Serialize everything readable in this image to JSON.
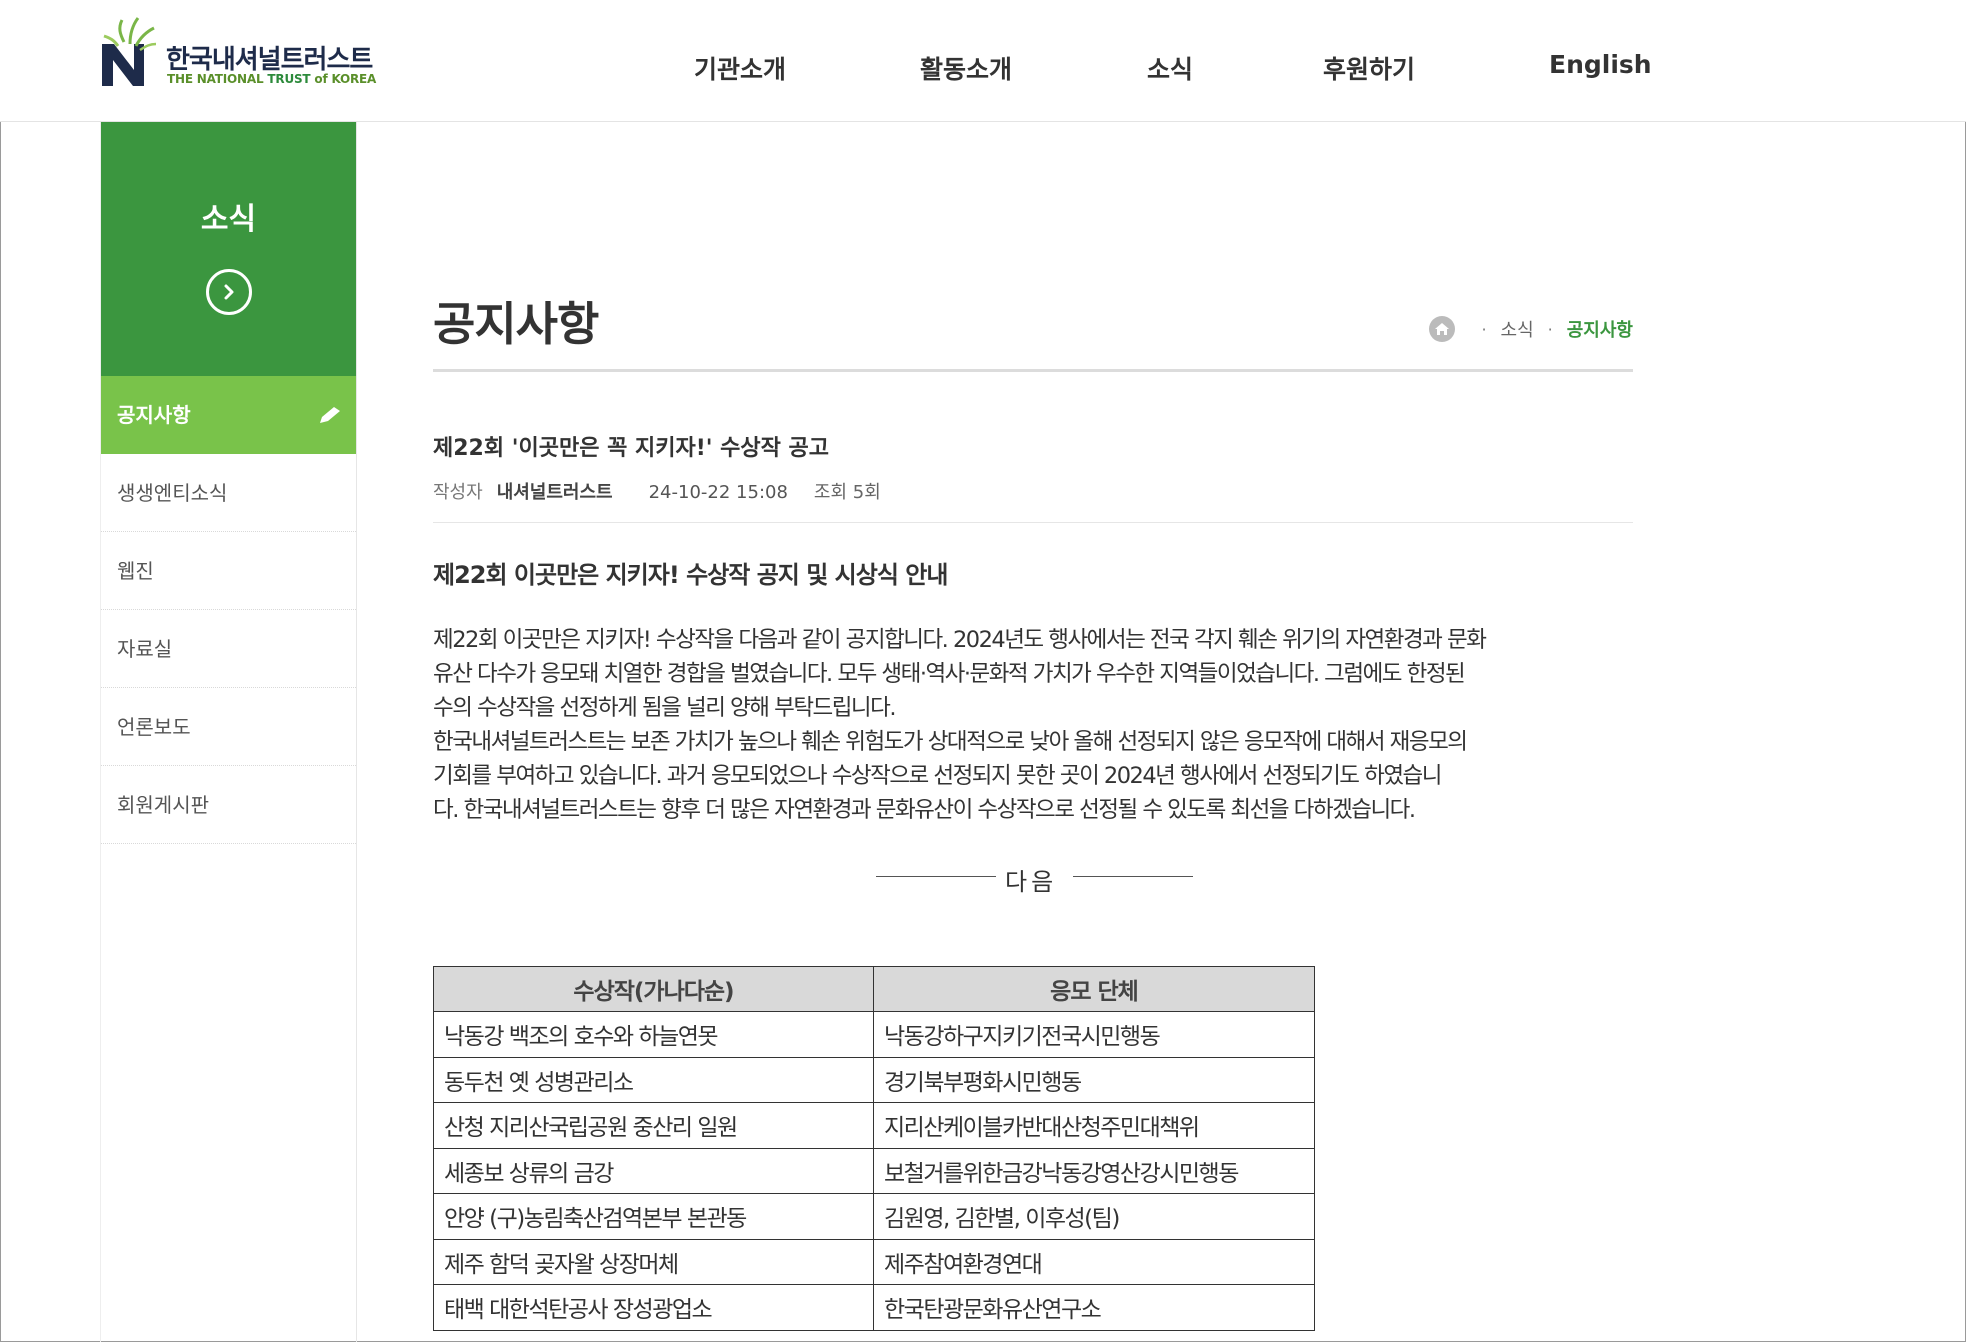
{
  "header": {
    "logo_ko": "한국내셔널트러스트",
    "logo_en_1": "THE NATIONAL ",
    "logo_en_2": "TRUST",
    "logo_en_3": " of KOREA",
    "nav": [
      "기관소개",
      "활동소개",
      "소식",
      "후원하기",
      "English"
    ]
  },
  "sidebar": {
    "title": "소식",
    "items": [
      "공지사항",
      "생생엔티소식",
      "웹진",
      "자료실",
      "언론보도",
      "회원게시판"
    ]
  },
  "page": {
    "title": "공지사항",
    "breadcrumb": [
      "소식",
      "공지사항"
    ]
  },
  "post": {
    "title": "제22회 '이곳만은 꼭 지키자!' 수상작 공고",
    "author_label": "작성자",
    "author": "내셔널트러스트",
    "date": "24-10-22 15:08",
    "views": "조회 5회",
    "heading": "제22회 이곳만은 지키자!  수상작 공지 및 시상식 안내",
    "paragraph_lines": [
      "제22회 이곳만은 지키자!  수상작을 다음과 같이 공지합니다. 2024년도 행사에서는 전국 각지 훼손 위기의 자연환경과 문화",
      "유산 다수가 응모돼 치열한 경합을 벌였습니다.  모두 생태·역사·문화적 가치가 우수한 지역들이었습니다.  그럼에도 한정된",
      "수의 수상작을 선정하게 됨을 널리 양해 부탁드립니다.",
      "한국내셔널트러스트는 보존 가치가 높으나 훼손 위험도가 상대적으로 낮아 올해 선정되지 않은 응모작에 대해서 재응모의",
      "기회를 부여하고 있습니다.  과거 응모되었으나 수상작으로 선정되지 못한 곳이  2024년 행사에서 선정되기도 하였습니",
      "다.  한국내셔널트러스트는 향후 더 많은 자연환경과 문화유산이 수상작으로 선정될 수 있도록 최선을 다하겠습니다."
    ],
    "divider": "다음",
    "table": {
      "headers": [
        "수상작(가나다순)",
        "응모 단체"
      ],
      "rows": [
        [
          "낙동강 백조의 호수와 하늘연못",
          "낙동강하구지키기전국시민행동"
        ],
        [
          "동두천 옛 성병관리소",
          "경기북부평화시민행동"
        ],
        [
          "산청 지리산국립공원 중산리 일원",
          "지리산케이블카반대산청주민대책위"
        ],
        [
          "세종보 상류의 금강",
          "보철거를위한금강낙동강영산강시민행동"
        ],
        [
          "안양 (구)농림축산검역본부 본관동",
          "김원영,  김한별,  이후성(팀)"
        ],
        [
          "제주 함덕 곶자왈 상장머체",
          "제주참여환경연대"
        ],
        [
          "태백 대한석탄공사 장성광업소",
          "한국탄광문화유산연구소"
        ]
      ]
    }
  },
  "colors": {
    "brand_green": "#3b963f",
    "active_green": "#79c34a",
    "navy": "#1e2b4a"
  }
}
